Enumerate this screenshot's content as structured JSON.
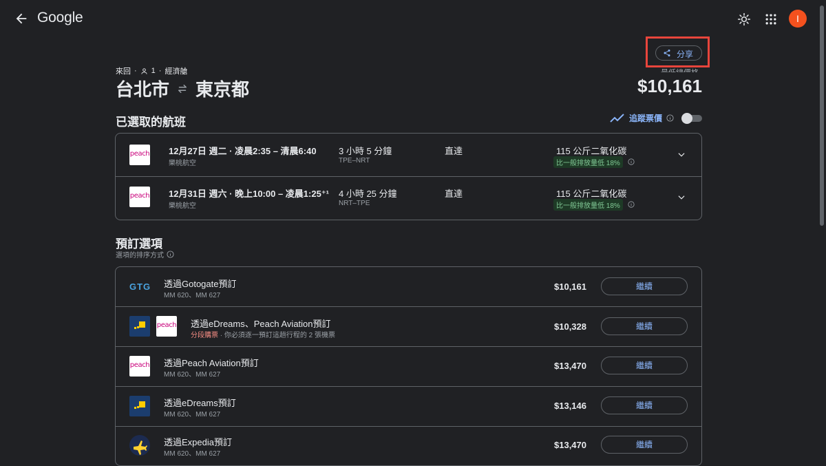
{
  "header": {
    "logo": "Google",
    "avatar_letter": "I"
  },
  "share": {
    "label": "分享",
    "lowest_label": "最低總價格"
  },
  "trip": {
    "type": "來回",
    "passengers": "1",
    "cabin": "經濟艙",
    "origin": "台北市",
    "destination": "東京都",
    "price": "$10,161"
  },
  "selected": {
    "title": "已選取的航班",
    "track_label": "追蹤票價"
  },
  "flights": [
    {
      "airline_logo": "peach",
      "date_time": "12月27日 週二 · 凌晨2:35 – 清晨6:40",
      "airline": "樂桃航空",
      "duration": "3 小時 5 分鐘",
      "route_code": "TPE–NRT",
      "stops": "直達",
      "co2": "115 公斤二氧化碳",
      "co2_badge": "比一般排放量低 18%"
    },
    {
      "airline_logo": "peach",
      "date_time": "12月31日 週六 · 晚上10:00 – 凌晨1:25⁺¹",
      "airline": "樂桃航空",
      "duration": "4 小時 25 分鐘",
      "route_code": "NRT–TPE",
      "stops": "直達",
      "co2": "115 公斤二氧化碳",
      "co2_badge": "比一般排放量低 18%"
    }
  ],
  "booking": {
    "title": "預訂選項",
    "sort_label": "選項的排序方式",
    "continue_label": "繼續",
    "options": [
      {
        "name": "透過Gotogate預訂",
        "flights": "MM 620、MM 627",
        "price": "$10,161",
        "logo": "GTG"
      },
      {
        "name": "透過eDreams、Peach Aviation預訂",
        "warning": "分段購票",
        "note": "· 你必須逐一預訂這趟行程的 2 張機票",
        "price": "$10,328"
      },
      {
        "name": "透過Peach Aviation預訂",
        "flights": "MM 620、MM 627",
        "price": "$13,470",
        "logo": "peach"
      },
      {
        "name": "透過eDreams預訂",
        "flights": "MM 620、MM 627",
        "price": "$13,146"
      },
      {
        "name": "透過Expedia預訂",
        "flights": "MM 620、MM 627",
        "price": "$13,470"
      }
    ]
  },
  "colors": {
    "background": "#202124",
    "accent": "#8ab4f8",
    "highlight": "#e8453c",
    "eco": "#81c995"
  }
}
